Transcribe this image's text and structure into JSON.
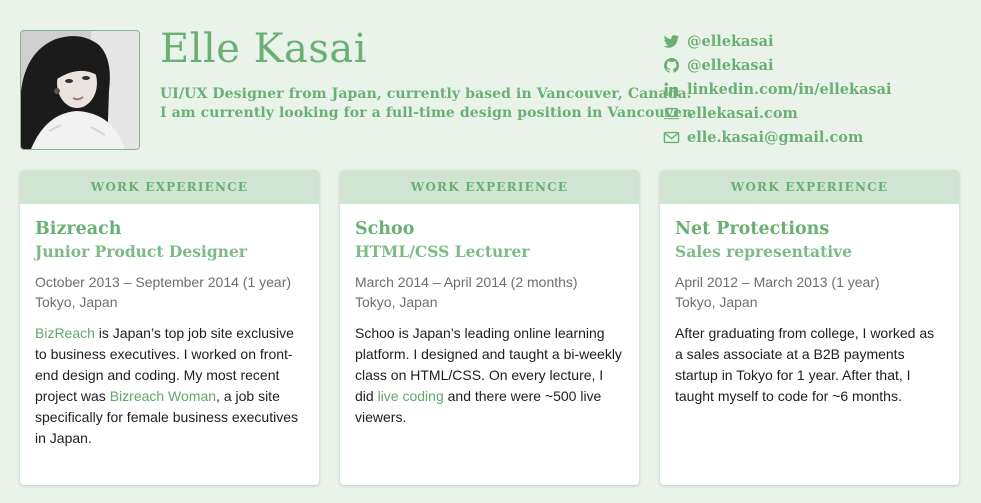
{
  "profile": {
    "name": "Elle Kasai",
    "bio_line1": "UI/UX Designer from Japan, currently based in Vancouver, Canada.",
    "bio_line2": "I am currently looking for a full-time design position in Vancouver."
  },
  "contacts": [
    {
      "icon": "twitter-icon",
      "text": "@ellekasai"
    },
    {
      "icon": "github-icon",
      "text": "@ellekasai"
    },
    {
      "icon": "linkedin-icon",
      "text": "linkedin.com/in/ellekasai"
    },
    {
      "icon": "laptop-icon",
      "text": "ellekasai.com"
    },
    {
      "icon": "envelope-icon",
      "text": "elle.kasai@gmail.com"
    }
  ],
  "colors": {
    "accent": "#6ab074",
    "header_band": "#cfe5d2",
    "background": "#eaf3ea"
  },
  "cards": [
    {
      "heading": "WORK EXPERIENCE",
      "company": "Bizreach",
      "role": "Junior Product Designer",
      "dates": "October 2013 – September 2014 (1 year)",
      "location": "Tokyo, Japan",
      "desc": {
        "link1": "BizReach",
        "text1": " is Japan’s top job site exclusive to business executives. I worked on front-end design and coding. My most recent project was ",
        "link2": "Bizreach Woman",
        "text2": ", a job site specifically for female business executives in Japan."
      }
    },
    {
      "heading": "WORK EXPERIENCE",
      "company": "Schoo",
      "role": "HTML/CSS Lecturer",
      "dates": "March 2014 – April 2014 (2 months)",
      "location": "Tokyo, Japan",
      "desc": {
        "text1": "Schoo is Japan’s leading online learning platform. I designed and taught a bi-weekly class on HTML/CSS. On every lecture, I did ",
        "link1": "live coding",
        "text2": " and there were ~500 live viewers."
      }
    },
    {
      "heading": "WORK EXPERIENCE",
      "company": "Net Protections",
      "role": "Sales representative",
      "dates": "April 2012 – March 2013 (1 year)",
      "location": "Tokyo, Japan",
      "desc": {
        "text1": "After graduating from college, I worked as a sales associate at a B2B payments startup in Tokyo for 1 year. After that, I taught myself to code for ~6 months."
      }
    }
  ]
}
